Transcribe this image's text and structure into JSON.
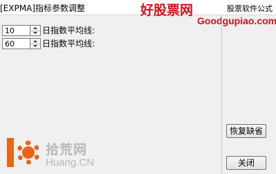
{
  "window": {
    "title": "[EXPMA]指标参数调整",
    "corner_text": "股票软件公式"
  },
  "watermark": {
    "site_name": "好股票网",
    "site_url": "Goodgupiao.com"
  },
  "params": [
    {
      "value": "10",
      "label": "日指数平均线:"
    },
    {
      "value": "60",
      "label": "日指数平均线:"
    }
  ],
  "buttons": {
    "restore_label": "恢复缺省",
    "close_label": "关闭"
  },
  "logo": {
    "number": "10",
    "cn_text": "拾荒网",
    "en_text": "Huang.CN"
  },
  "colors": {
    "watermark_red": "#d6101c",
    "logo_orange": "#e8651a"
  }
}
